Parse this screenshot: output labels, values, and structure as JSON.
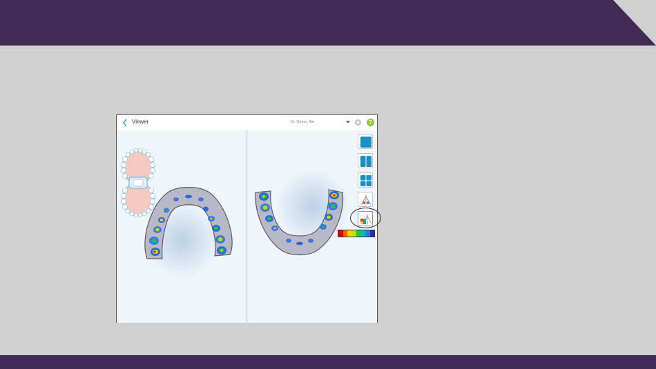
{
  "viewer": {
    "title": "Viewer",
    "user": "Dr. Demo, Kio"
  },
  "help": {
    "label": "?"
  },
  "colors": {
    "banner": "#412a56",
    "slide_bg": "#d0d0d0",
    "accent": "#1a8fc0",
    "help_green": "#8cc63f"
  },
  "toolbar": {
    "buttons": [
      {
        "name": "single-view-button",
        "icon": "single-pane-icon"
      },
      {
        "name": "dual-view-button",
        "icon": "dual-pane-icon"
      },
      {
        "name": "quad-view-button",
        "icon": "quad-pane-icon"
      },
      {
        "name": "occlusion-tool-button",
        "icon": "occlusion-tool-icon"
      },
      {
        "name": "occlusion-map-button",
        "icon": "occlusion-color-map-icon",
        "selected": true
      }
    ]
  },
  "scale_colors": [
    "#e30000",
    "#ff6a00",
    "#ffd200",
    "#b8e000",
    "#22c05a",
    "#00b8c8",
    "#2a7de0",
    "#3428c0"
  ]
}
